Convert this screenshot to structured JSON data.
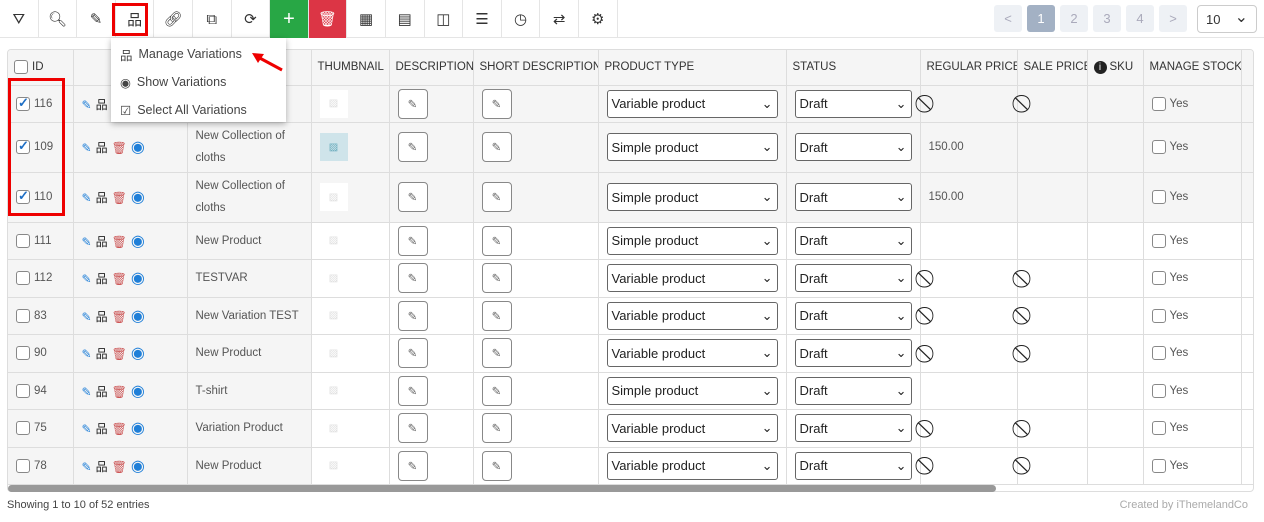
{
  "toolbar": {
    "items": [
      {
        "name": "filter-icon",
        "glyph": "⛛"
      },
      {
        "name": "search-icon",
        "glyph": "🔍︎"
      },
      {
        "name": "edit-icon",
        "glyph": "✎"
      },
      {
        "name": "variations-icon",
        "glyph": "品"
      },
      {
        "name": "link-icon",
        "glyph": "🔗︎"
      },
      {
        "name": "duplicate-icon",
        "glyph": "⧉"
      },
      {
        "name": "refresh-icon",
        "glyph": "⟳"
      },
      {
        "name": "add-icon",
        "glyph": "+"
      },
      {
        "name": "trash-icon",
        "glyph": "🗑︎"
      },
      {
        "name": "table-icon",
        "glyph": "▦"
      },
      {
        "name": "column-layout-icon",
        "glyph": "▤"
      },
      {
        "name": "columns-icon",
        "glyph": "◫"
      },
      {
        "name": "list-icon",
        "glyph": "☰"
      },
      {
        "name": "history-icon",
        "glyph": "◷"
      },
      {
        "name": "swap-icon",
        "glyph": "⇄"
      },
      {
        "name": "settings-icon",
        "glyph": "⚙"
      }
    ]
  },
  "pagination": {
    "prev": "<",
    "pages": [
      "1",
      "2",
      "3",
      "4"
    ],
    "next": ">",
    "active": "1",
    "per_page": "10"
  },
  "menu": {
    "items": [
      "Manage Variations",
      "Show Variations",
      "Select All Variations"
    ]
  },
  "columns": [
    "ID",
    "",
    "",
    "THUMBNAIL",
    "DESCRIPTION",
    "SHORT DESCRIPTION",
    "PRODUCT TYPE",
    "STATUS",
    "REGULAR PRICE",
    "SALE PRICE",
    "SKU",
    "MANAGE STOCK"
  ],
  "rows": [
    {
      "id": "116",
      "checked": true,
      "name": "",
      "thumb": "blank",
      "type": "Variable product",
      "status": "Draft",
      "regular": "⃠",
      "sale": "⃠",
      "stock": "Yes"
    },
    {
      "id": "109",
      "checked": true,
      "name": "New Collection of cloths",
      "thumb": "image",
      "type": "Simple product",
      "status": "Draft",
      "regular": "150.00",
      "sale": "",
      "stock": "Yes"
    },
    {
      "id": "110",
      "checked": true,
      "name": "New Collection of cloths",
      "thumb": "blank",
      "type": "Simple product",
      "status": "Draft",
      "regular": "150.00",
      "sale": "",
      "stock": "Yes"
    },
    {
      "id": "111",
      "checked": false,
      "name": "New Product",
      "thumb": "blank",
      "type": "Simple product",
      "status": "Draft",
      "regular": "",
      "sale": "",
      "stock": "Yes"
    },
    {
      "id": "112",
      "checked": false,
      "name": "TESTVAR",
      "thumb": "blank",
      "type": "Variable product",
      "status": "Draft",
      "regular": "⃠",
      "sale": "⃠",
      "stock": "Yes"
    },
    {
      "id": "83",
      "checked": false,
      "name": "New Variation TEST",
      "thumb": "blank",
      "type": "Variable product",
      "status": "Draft",
      "regular": "⃠",
      "sale": "⃠",
      "stock": "Yes"
    },
    {
      "id": "90",
      "checked": false,
      "name": "New Product",
      "thumb": "blank",
      "type": "Variable product",
      "status": "Draft",
      "regular": "⃠",
      "sale": "⃠",
      "stock": "Yes"
    },
    {
      "id": "94",
      "checked": false,
      "name": "T-shirt",
      "thumb": "blank",
      "type": "Simple product",
      "status": "Draft",
      "regular": "",
      "sale": "",
      "stock": "Yes"
    },
    {
      "id": "75",
      "checked": false,
      "name": "Variation Product",
      "thumb": "blank",
      "type": "Variable product",
      "status": "Draft",
      "regular": "⃠",
      "sale": "⃠",
      "stock": "Yes"
    },
    {
      "id": "78",
      "checked": false,
      "name": "New Product",
      "thumb": "blank",
      "type": "Variable product",
      "status": "Draft",
      "regular": "⃠",
      "sale": "⃠",
      "stock": "Yes"
    }
  ],
  "footer": {
    "showing": "Showing 1 to 10 of 52 entries",
    "credit": "Created by iThemelandCo"
  }
}
